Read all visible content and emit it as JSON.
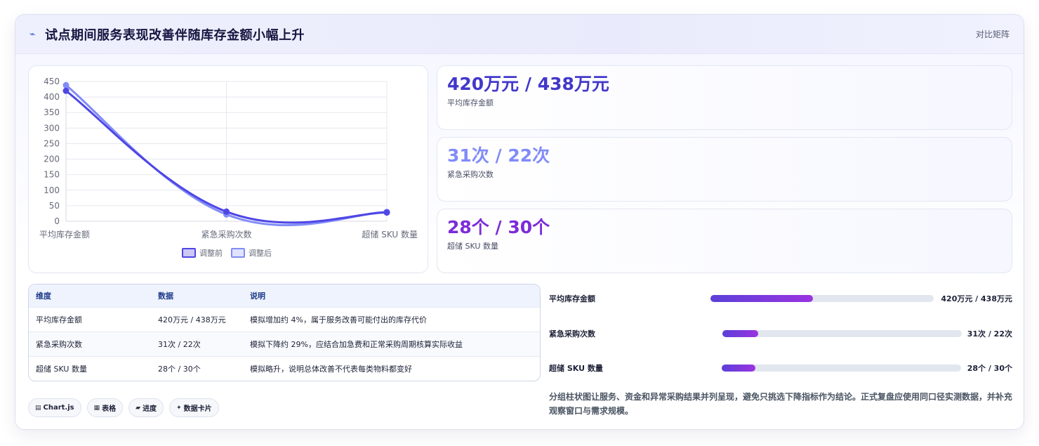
{
  "header": {
    "icon": "zap-icon",
    "title": "试点期间服务表现改善伴随库存金额小幅上升",
    "tag": "对比矩阵"
  },
  "colors": {
    "before": "#4f46e5",
    "after": "#818cf8",
    "accent_third": "#7c2bd9",
    "progress_start": "#5b40d8",
    "progress_end": "#9a34e0"
  },
  "chart_data": {
    "type": "line",
    "categories": [
      "平均库存金额",
      "紧急采购次数",
      "超储 SKU 数量"
    ],
    "series": [
      {
        "name": "调整前",
        "values": [
          420,
          31,
          28
        ]
      },
      {
        "name": "调整后",
        "values": [
          438,
          22,
          30
        ]
      }
    ],
    "ylim": [
      0,
      450
    ],
    "yticks": [
      "0",
      "50",
      "100",
      "150",
      "200",
      "250",
      "300",
      "350",
      "400",
      "450"
    ],
    "grid": true,
    "legend": "bottom"
  },
  "stats": [
    {
      "value": "420万元 / 438万元",
      "label": "平均库存金额",
      "color": "#4338ca"
    },
    {
      "value": "31次 / 22次",
      "label": "紧急采购次数",
      "color": "#818cf8"
    },
    {
      "value": "28个 / 30个",
      "label": "超储 SKU 数量",
      "color": "#7c2bd9"
    }
  ],
  "table": {
    "headers": [
      "维度",
      "数据",
      "说明"
    ],
    "rows": [
      [
        "平均库存金额",
        "420万元 / 438万元",
        "模拟增加约 4%，属于服务改善可能付出的库存代价"
      ],
      [
        "紧急采购次数",
        "31次 / 22次",
        "模拟下降约 29%，应结合加急费和正常采购周期核算实际收益"
      ],
      [
        "超储 SKU 数量",
        "28个 / 30个",
        "模拟略升，说明总体改善不代表每类物料都变好"
      ]
    ]
  },
  "pills": [
    {
      "icon": "chart-icon",
      "glyph": "▤",
      "label": "Chart.js"
    },
    {
      "icon": "table-icon",
      "glyph": "▦",
      "label": "表格"
    },
    {
      "icon": "progress-icon",
      "glyph": "▰",
      "label": "进度"
    },
    {
      "icon": "sparkle-icon",
      "glyph": "✦",
      "label": "数据卡片"
    }
  ],
  "progress": [
    {
      "label": "平均库存金额",
      "value": "420万元 / 438万元",
      "fraction": 0.46
    },
    {
      "label": "紧急采购次数",
      "value": "31次 / 22次",
      "fraction": 0.15
    },
    {
      "label": "超储 SKU 数量",
      "value": "28个 / 30个",
      "fraction": 0.14
    }
  ],
  "note": "分组柱状图让服务、资金和异常采购结果并列呈现，避免只挑选下降指标作为结论。正式复盘应使用同口径实测数据，并补充观察窗口与需求规模。"
}
